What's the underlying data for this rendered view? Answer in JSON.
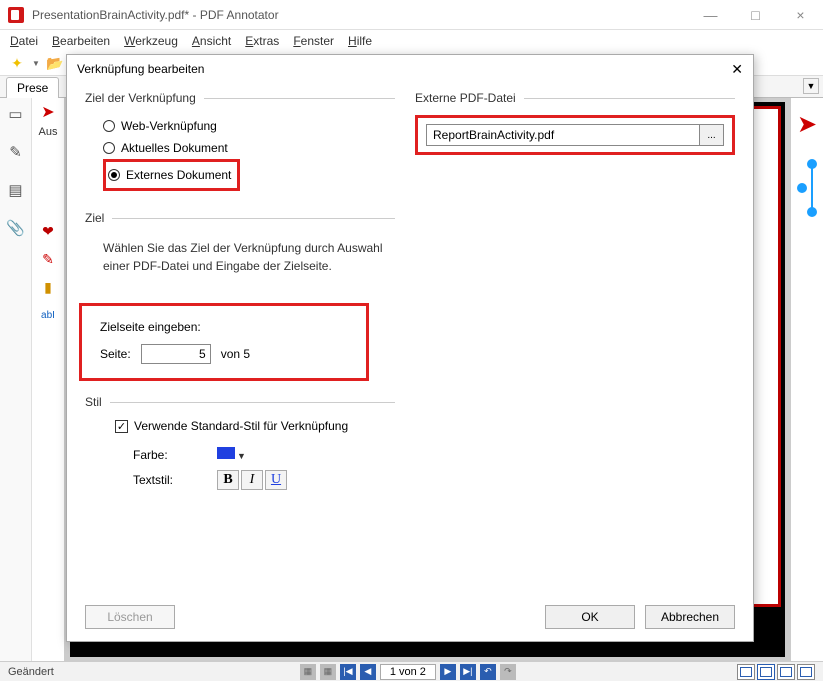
{
  "window": {
    "title": "PresentationBrainActivity.pdf* - PDF Annotator",
    "minimize": "—",
    "maximize": "□",
    "close": "×"
  },
  "menu": {
    "file": "Datei",
    "edit": "Bearbeiten",
    "tool": "Werkzeug",
    "view": "Ansicht",
    "extras": "Extras",
    "window": "Fenster",
    "help": "Hilfe"
  },
  "tab": {
    "label": "Prese"
  },
  "left_col2": {
    "aus": "Aus"
  },
  "dialog": {
    "title": "Verknüpfung bearbeiten",
    "close": "✕",
    "link_target_section": "Ziel der Verknüpfung",
    "radio_web": "Web-Verknüpfung",
    "radio_current": "Aktuelles Dokument",
    "radio_external": "Externes Dokument",
    "ziel_section": "Ziel",
    "ziel_desc": "Wählen Sie das Ziel der Verknüpfung durch Auswahl einer PDF-Datei und Eingabe der Zielseite.",
    "target_page_label": "Zielseite eingeben:",
    "page_label": "Seite:",
    "page_value": "5",
    "of_total": "von 5",
    "stil_section": "Stil",
    "use_default_style": "Verwende Standard-Stil für Verknüpfung",
    "color_label": "Farbe:",
    "textstyle_label": "Textstil:",
    "bold": "B",
    "italic": "I",
    "underline": "U",
    "ext_file_section": "Externe PDF-Datei",
    "ext_file_value": "ReportBrainActivity.pdf",
    "browse": "...",
    "delete": "Löschen",
    "ok": "OK",
    "cancel": "Abbrechen"
  },
  "statusbar": {
    "modified": "Geändert",
    "page_display": "1 von 2"
  }
}
